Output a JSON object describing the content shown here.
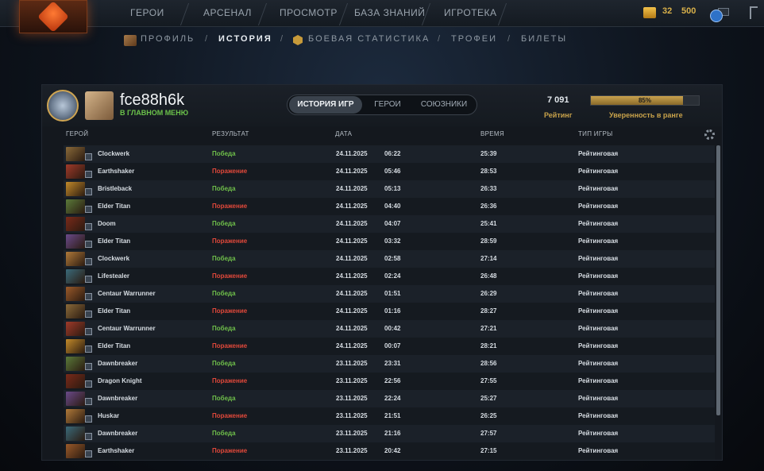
{
  "nav": {
    "items": [
      "ГЕРОИ",
      "АРСЕНАЛ",
      "ПРОСМОТР",
      "БАЗА ЗНАНИЙ",
      "ИГРОТЕКА"
    ],
    "currency_a": "32",
    "currency_b": "500"
  },
  "subnav": {
    "items": [
      "ПРОФИЛЬ",
      "ИСТОРИЯ",
      "БОЕВАЯ СТАТИСТИКА",
      "ТРОФЕИ",
      "БИЛЕТЫ"
    ],
    "separator": "/"
  },
  "profile": {
    "username": "fce88h6k",
    "status": "В ГЛАВНОМ МЕНЮ",
    "tabs": [
      "ИСТОРИЯ ИГР",
      "ГЕРОИ",
      "СОЮЗНИКИ"
    ],
    "rating_value": "7 091",
    "rating_label": "Рейтинг",
    "confidence_pct": "85%",
    "confidence_fraction": 0.85,
    "confidence_label": "Уверенность в ранге"
  },
  "table": {
    "headers": [
      "ГЕРОЙ",
      "РЕЗУЛЬТАТ",
      "ДАТА",
      "ВРЕМЯ",
      "ТИП ИГРЫ"
    ],
    "rows": [
      {
        "hero": "Clockwerk",
        "result": "Победа",
        "win": true,
        "date": "24.11.2025",
        "time": "06:22",
        "duration": "25:39",
        "type": "Рейтинговая"
      },
      {
        "hero": "Earthshaker",
        "result": "Поражение",
        "win": false,
        "date": "24.11.2025",
        "time": "05:46",
        "duration": "28:53",
        "type": "Рейтинговая"
      },
      {
        "hero": "Bristleback",
        "result": "Победа",
        "win": true,
        "date": "24.11.2025",
        "time": "05:13",
        "duration": "26:33",
        "type": "Рейтинговая"
      },
      {
        "hero": "Elder Titan",
        "result": "Поражение",
        "win": false,
        "date": "24.11.2025",
        "time": "04:40",
        "duration": "26:36",
        "type": "Рейтинговая"
      },
      {
        "hero": "Doom",
        "result": "Победа",
        "win": true,
        "date": "24.11.2025",
        "time": "04:07",
        "duration": "25:41",
        "type": "Рейтинговая"
      },
      {
        "hero": "Elder Titan",
        "result": "Поражение",
        "win": false,
        "date": "24.11.2025",
        "time": "03:32",
        "duration": "28:59",
        "type": "Рейтинговая"
      },
      {
        "hero": "Clockwerk",
        "result": "Победа",
        "win": true,
        "date": "24.11.2025",
        "time": "02:58",
        "duration": "27:14",
        "type": "Рейтинговая"
      },
      {
        "hero": "Lifestealer",
        "result": "Поражение",
        "win": false,
        "date": "24.11.2025",
        "time": "02:24",
        "duration": "26:48",
        "type": "Рейтинговая"
      },
      {
        "hero": "Centaur Warrunner",
        "result": "Победа",
        "win": true,
        "date": "24.11.2025",
        "time": "01:51",
        "duration": "26:29",
        "type": "Рейтинговая"
      },
      {
        "hero": "Elder Titan",
        "result": "Поражение",
        "win": false,
        "date": "24.11.2025",
        "time": "01:16",
        "duration": "28:27",
        "type": "Рейтинговая"
      },
      {
        "hero": "Centaur Warrunner",
        "result": "Победа",
        "win": true,
        "date": "24.11.2025",
        "time": "00:42",
        "duration": "27:21",
        "type": "Рейтинговая"
      },
      {
        "hero": "Elder Titan",
        "result": "Поражение",
        "win": false,
        "date": "24.11.2025",
        "time": "00:07",
        "duration": "28:21",
        "type": "Рейтинговая"
      },
      {
        "hero": "Dawnbreaker",
        "result": "Победа",
        "win": true,
        "date": "23.11.2025",
        "time": "23:31",
        "duration": "28:56",
        "type": "Рейтинговая"
      },
      {
        "hero": "Dragon Knight",
        "result": "Поражение",
        "win": false,
        "date": "23.11.2025",
        "time": "22:56",
        "duration": "27:55",
        "type": "Рейтинговая"
      },
      {
        "hero": "Dawnbreaker",
        "result": "Победа",
        "win": true,
        "date": "23.11.2025",
        "time": "22:24",
        "duration": "25:27",
        "type": "Рейтинговая"
      },
      {
        "hero": "Huskar",
        "result": "Поражение",
        "win": false,
        "date": "23.11.2025",
        "time": "21:51",
        "duration": "26:25",
        "type": "Рейтинговая"
      },
      {
        "hero": "Dawnbreaker",
        "result": "Победа",
        "win": true,
        "date": "23.11.2025",
        "time": "21:16",
        "duration": "27:57",
        "type": "Рейтинговая"
      },
      {
        "hero": "Earthshaker",
        "result": "Поражение",
        "win": false,
        "date": "23.11.2025",
        "time": "20:42",
        "duration": "27:15",
        "type": "Рейтинговая"
      }
    ]
  },
  "colors": {
    "win": "#6fbf4a",
    "loss": "#e0483a",
    "accent_gold": "#c8a24a"
  }
}
